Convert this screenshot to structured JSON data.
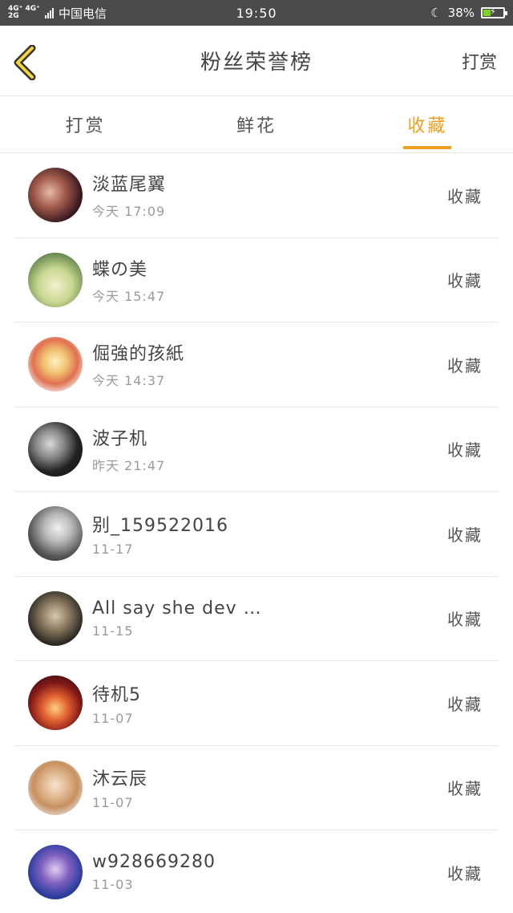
{
  "status_bar": {
    "network_top": "4G⁺ 4G⁺",
    "network_bottom": "2G",
    "carrier": "中国电信",
    "time": "19:50",
    "battery": "38%",
    "battery_level": 0.38
  },
  "nav": {
    "title": "粉丝荣誉榜",
    "action": "打赏"
  },
  "tabs": [
    {
      "label": "打赏"
    },
    {
      "label": "鲜花"
    },
    {
      "label": "收藏"
    }
  ],
  "active_tab": "收藏",
  "users": [
    {
      "name": "淡蓝尾翼",
      "time": "今天 17:09",
      "action": "收藏"
    },
    {
      "name": "蝶の美",
      "time": "今天 15:47",
      "action": "收藏"
    },
    {
      "name": "倔強的孩紙",
      "time": "今天 14:37",
      "action": "收藏"
    },
    {
      "name": "波子机",
      "time": "昨天 21:47",
      "action": "收藏"
    },
    {
      "name": "别_159522016",
      "time": "11-17",
      "action": "收藏"
    },
    {
      "name": "All say she dev …",
      "time": "11-15",
      "action": "收藏"
    },
    {
      "name": "待机5",
      "time": "11-07",
      "action": "收藏"
    },
    {
      "name": "沐云辰",
      "time": "11-07",
      "action": "收藏"
    },
    {
      "name": "w928669280",
      "time": "11-03",
      "action": "收藏"
    }
  ],
  "colors": {
    "accent": "#f0a020",
    "status_bar": "#4a4a4a",
    "divider": "#e6e6e6"
  }
}
